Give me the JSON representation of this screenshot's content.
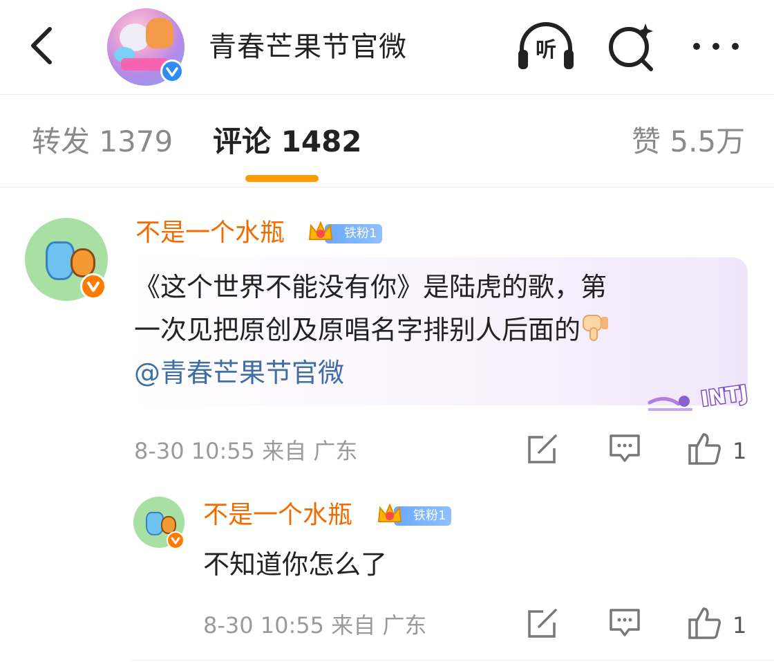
{
  "header": {
    "title": "青春芒果节官微",
    "listen_label": "听",
    "icons": {
      "back": "back-arrow-icon",
      "listen": "headphones-icon",
      "search": "search-sparkle-icon",
      "more": "more-dots-icon"
    }
  },
  "tabs": [
    {
      "label": "转发 1379",
      "active": false
    },
    {
      "label": "评论 1482",
      "active": true
    },
    {
      "label": "赞 5.5万",
      "active": false
    }
  ],
  "colors": {
    "accent": "#ff9b00",
    "username": "#f26b00",
    "mention": "#3f6ea6",
    "verify_blue": "#2e8df5",
    "verify_orange": "#ff7a00"
  },
  "comment": {
    "username": "不是一个水瓶",
    "fan_badge": "铁粉1",
    "crown_level": "4",
    "text_lines": [
      "《这个世界不能没有你》是陆虎的歌，第",
      "一次见把原创及原唱名字排别人后面的"
    ],
    "emoji": "thumbs-down-emoji",
    "mention": "@青春芒果节官微",
    "sticker": "INTJ",
    "meta": "8-30 10:55  来自 广东",
    "like_count": "1"
  },
  "reply": {
    "username": "不是一个水瓶",
    "fan_badge": "铁粉1",
    "crown_level": "4",
    "text": "不知道你怎么了",
    "meta": "8-30 10:55  来自 广东",
    "like_count": "1"
  }
}
